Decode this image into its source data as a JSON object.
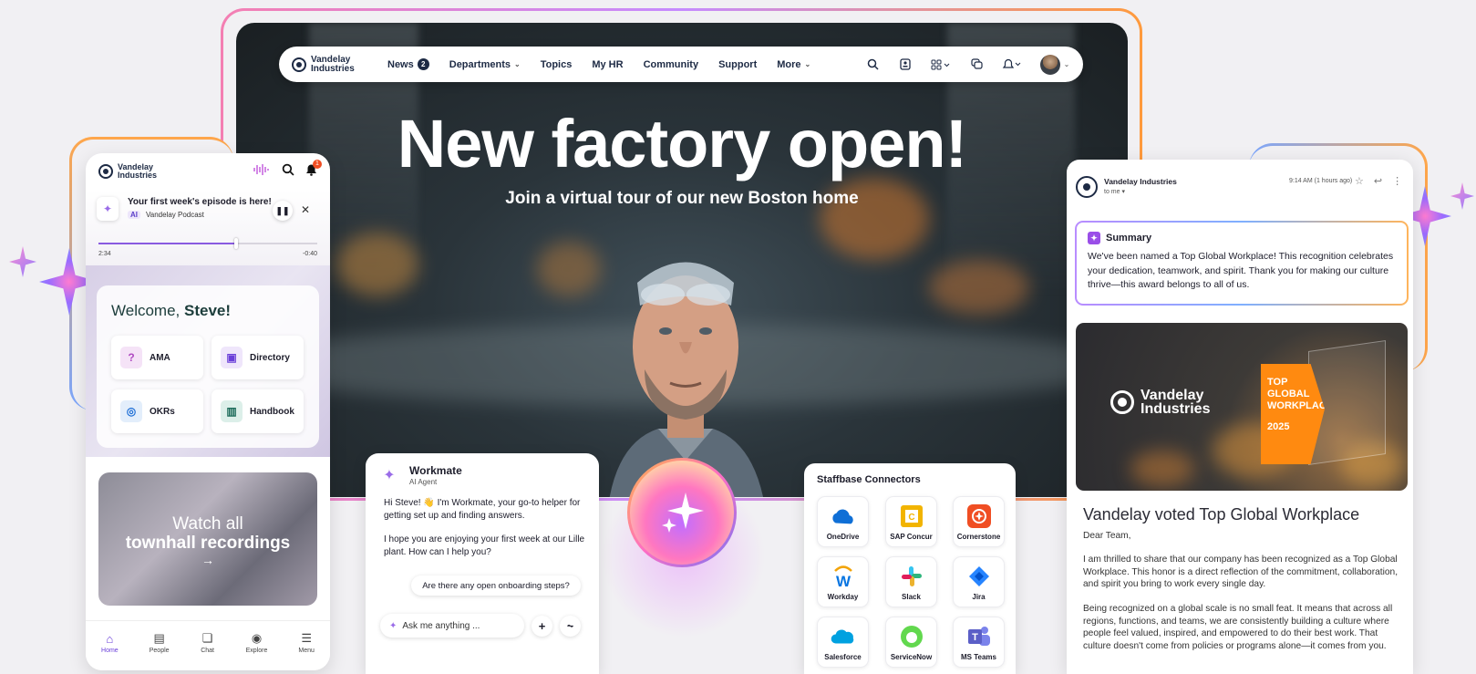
{
  "desktop": {
    "brand": "Vandelay Industries",
    "nav": [
      {
        "label": "News",
        "badge": "2"
      },
      {
        "label": "Departments",
        "dropdown": true
      },
      {
        "label": "Topics"
      },
      {
        "label": "My HR"
      },
      {
        "label": "Community"
      },
      {
        "label": "Support"
      },
      {
        "label": "More",
        "dropdown": true
      }
    ],
    "icons": [
      "search-icon",
      "contact-card-icon",
      "apps-grid-icon",
      "chat-icon",
      "bell-icon",
      "user-avatar"
    ],
    "hero_title": "New factory open!",
    "hero_subtitle": "Join a virtual tour of our new Boston home"
  },
  "phone": {
    "brand": "Vandelay Industries",
    "notification_count": "1",
    "podcast": {
      "title": "Your first week's episode is here!",
      "ai_tag": "AI",
      "source": "Vandelay Podcast",
      "elapsed": "2:34",
      "remaining": "-0:40",
      "progress": 0.63
    },
    "welcome_prefix": "Welcome, ",
    "welcome_name": "Steve!",
    "tiles": [
      {
        "label": "AMA",
        "icon": "question-icon"
      },
      {
        "label": "Directory",
        "icon": "directory-icon"
      },
      {
        "label": "OKRs",
        "icon": "target-icon"
      },
      {
        "label": "Handbook",
        "icon": "books-icon"
      }
    ],
    "townhall_line1": "Watch all",
    "townhall_line2": "townhall recordings",
    "townhall_arrow": "→",
    "tabs": [
      {
        "label": "Home",
        "icon": "home-icon",
        "active": true
      },
      {
        "label": "People",
        "icon": "people-icon"
      },
      {
        "label": "Chat",
        "icon": "chat-icon"
      },
      {
        "label": "Explore",
        "icon": "compass-icon"
      },
      {
        "label": "Menu",
        "icon": "menu-icon"
      }
    ]
  },
  "workmate": {
    "name": "Workmate",
    "role": "AI Agent",
    "message1": "Hi Steve! 👋 I'm Workmate, your go-to helper for getting set up and finding answers.",
    "message2": "I hope you are enjoying your first week at our Lille plant. How can I help you?",
    "suggestion": "Are there any open onboarding steps?",
    "input_placeholder": "Ask me anything ..."
  },
  "connectors": {
    "title": "Staffbase Connectors",
    "items": [
      {
        "label": "OneDrive",
        "color": "#0f6fd6"
      },
      {
        "label": "SAP Concur",
        "color": "#f2b400"
      },
      {
        "label": "Cornerstone",
        "color": "#f04e23"
      },
      {
        "label": "Workday",
        "color": "#0875e1"
      },
      {
        "label": "Slack",
        "color": "#4a154b"
      },
      {
        "label": "Jira",
        "color": "#2684ff"
      },
      {
        "label": "Salesforce",
        "color": "#00a1e0"
      },
      {
        "label": "ServiceNow",
        "color": "#62d84e"
      },
      {
        "label": "MS Teams",
        "color": "#5b5fc7"
      }
    ]
  },
  "email": {
    "from": "Vandelay Industries",
    "to": "to me ▾",
    "time": "9:14 AM (1 hours ago)",
    "summary_title": "Summary",
    "summary_body": "We've been named a Top Global Workplace! This recognition celebrates your dedication, teamwork, and spirit. Thank you for making our culture thrive—this award belongs to all of us.",
    "banner_brand": "Vandelay Industries",
    "award_line1": "TOP",
    "award_line2": "GLOBAL",
    "award_line3": "WORKPLACE",
    "award_year": "2025",
    "title": "Vandelay voted Top Global Workplace",
    "greeting": "Dear Team,",
    "para1": "I am thrilled to share that  our company has been recognized as a Top Global Workplace. This honor is a direct reflection of the commitment, collaboration, and spirit you bring to work every single day.",
    "para2": "Being recognized on a global scale is no small feat. It means that across all regions, functions, and teams, we are consistently building a culture where people feel valued, inspired, and empowered to do their best work. That culture doesn't come from policies or programs alone—it comes from you."
  },
  "colors": {
    "brand_navy": "#1d2a44",
    "accent_purple": "#8a5be0",
    "award_orange": "#ff8a10"
  }
}
